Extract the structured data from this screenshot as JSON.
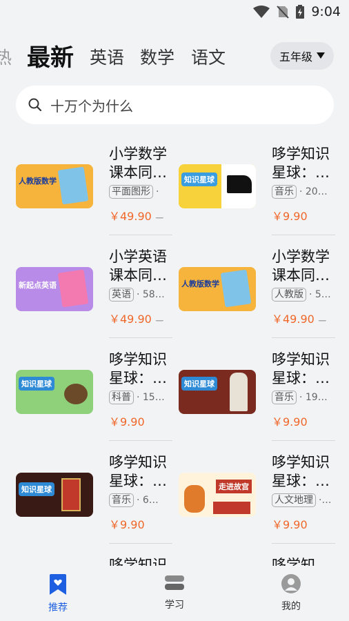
{
  "status": {
    "time": "9:04"
  },
  "tabs": [
    {
      "label": "热"
    },
    {
      "label": "最新"
    },
    {
      "label": "英语"
    },
    {
      "label": "数学"
    },
    {
      "label": "语文"
    }
  ],
  "grade_button": {
    "label": "五年级"
  },
  "search": {
    "placeholder": "十万个为什么"
  },
  "courses": [
    {
      "title": "小学数学课本同…",
      "tag": "平面图形",
      "count": "·",
      "price": "￥49.90",
      "original": "—",
      "thumb": "人教版数学"
    },
    {
      "title": "哆学知识星球：…",
      "tag": "音乐",
      "count": "· 20…",
      "price": "￥9.90",
      "original": "",
      "thumb": "知识星球"
    },
    {
      "title": "小学英语课本同…",
      "tag": "英语",
      "count": "· 58…",
      "price": "￥49.90",
      "original": "—",
      "thumb": "新起点英语"
    },
    {
      "title": "小学数学课本同…",
      "tag": "人教版",
      "count": "· 5…",
      "price": "￥49.90",
      "original": "—",
      "thumb": "人教版数学"
    },
    {
      "title": "哆学知识星球：…",
      "tag": "科普",
      "count": "· 15…",
      "price": "￥9.90",
      "original": "",
      "thumb": "知识星球"
    },
    {
      "title": "哆学知识星球：…",
      "tag": "音乐",
      "count": "· 19…",
      "price": "￥9.90",
      "original": "",
      "thumb": "知识星球"
    },
    {
      "title": "哆学知识星球：…",
      "tag": "音乐",
      "count": "· 6…",
      "price": "￥9.90",
      "original": "",
      "thumb": "知识星球"
    },
    {
      "title": "哆学知识星球：…",
      "tag": "人文地理",
      "count": "·…",
      "price": "￥9.90",
      "original": "",
      "thumb": "走进故宫"
    },
    {
      "title": "哆学知识",
      "tag": "",
      "count": "",
      "price": "",
      "original": "",
      "thumb": ""
    },
    {
      "title": "哆学知",
      "tag": "",
      "count": "",
      "price": "",
      "original": "",
      "thumb": ""
    }
  ],
  "bottom_nav": [
    {
      "label": "推荐"
    },
    {
      "label": "学习"
    },
    {
      "label": "我的"
    }
  ],
  "colors": {
    "accent": "#1d5fe0",
    "price": "#f0672a",
    "background": "#f1f3f5"
  }
}
